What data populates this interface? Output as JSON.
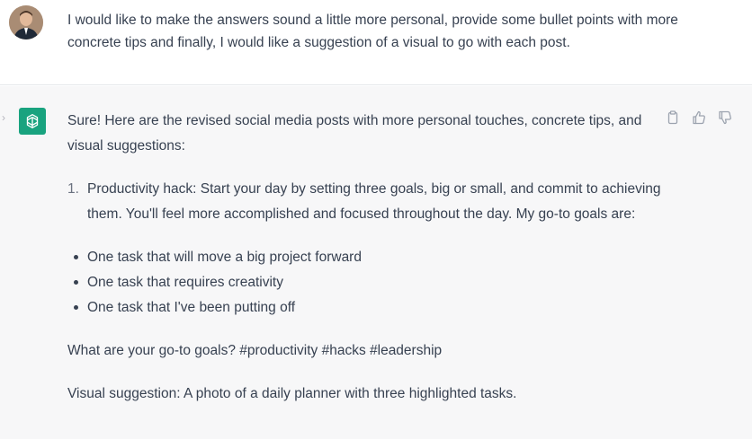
{
  "user_message": {
    "text": "I would like to make the answers sound a little more personal, provide some bullet points with more concrete tips and finally, I would like a suggestion of a visual to go with each post."
  },
  "assistant_message": {
    "intro": "Sure! Here are the revised social media posts with more personal touches, concrete tips, and visual suggestions:",
    "items": [
      {
        "number": "1.",
        "text": "Productivity hack: Start your day by setting three goals, big or small, and commit to achieving them. You'll feel more accomplished and focused throughout the day. My go-to goals are:"
      }
    ],
    "bullets": [
      "One task that will move a big project forward",
      "One task that requires creativity",
      "One task that I've been putting off"
    ],
    "closing_question": "What are your go-to goals? #productivity #hacks #leadership",
    "visual_suggestion": "Visual suggestion: A photo of a daily planner with three highlighted tasks."
  },
  "actions": {
    "icons": [
      "copy-icon",
      "thumbs-up-icon",
      "thumbs-down-icon"
    ]
  },
  "colors": {
    "assistant_bg": "#f7f7f8",
    "gpt_icon_bg": "#19a37f",
    "text": "#374151"
  }
}
